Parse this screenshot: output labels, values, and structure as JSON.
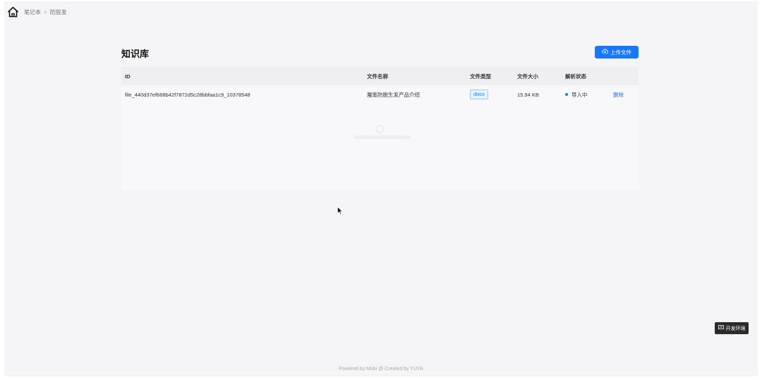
{
  "breadcrumb": {
    "items": [
      "笔记本",
      "防脱发"
    ],
    "separator": ">"
  },
  "page": {
    "title": "知识库",
    "upload_label": "上传文件"
  },
  "table": {
    "headers": {
      "id": "ID",
      "name": "文件名称",
      "type": "文件类型",
      "size": "文件大小",
      "status": "解析状态"
    },
    "rows": [
      {
        "id": "file_440d37ef668b42f7872d5c28bbfaa1c9_10378548",
        "name": "魔笔防脱生发产品介绍",
        "type": "docx",
        "size": "15.94 KB",
        "status": "导入中",
        "action": "删除"
      }
    ]
  },
  "env_badge": "开发环境",
  "footer": "Powered by Mobi @ Created by YUYA",
  "colors": {
    "primary": "#1677ff",
    "background": "#f5f5f7",
    "header_bg": "#efeff1"
  },
  "icons": {
    "home": "home-icon",
    "upload": "cloud-upload-icon",
    "env": "monitor-icon",
    "cursor": "mouse-pointer-icon"
  }
}
